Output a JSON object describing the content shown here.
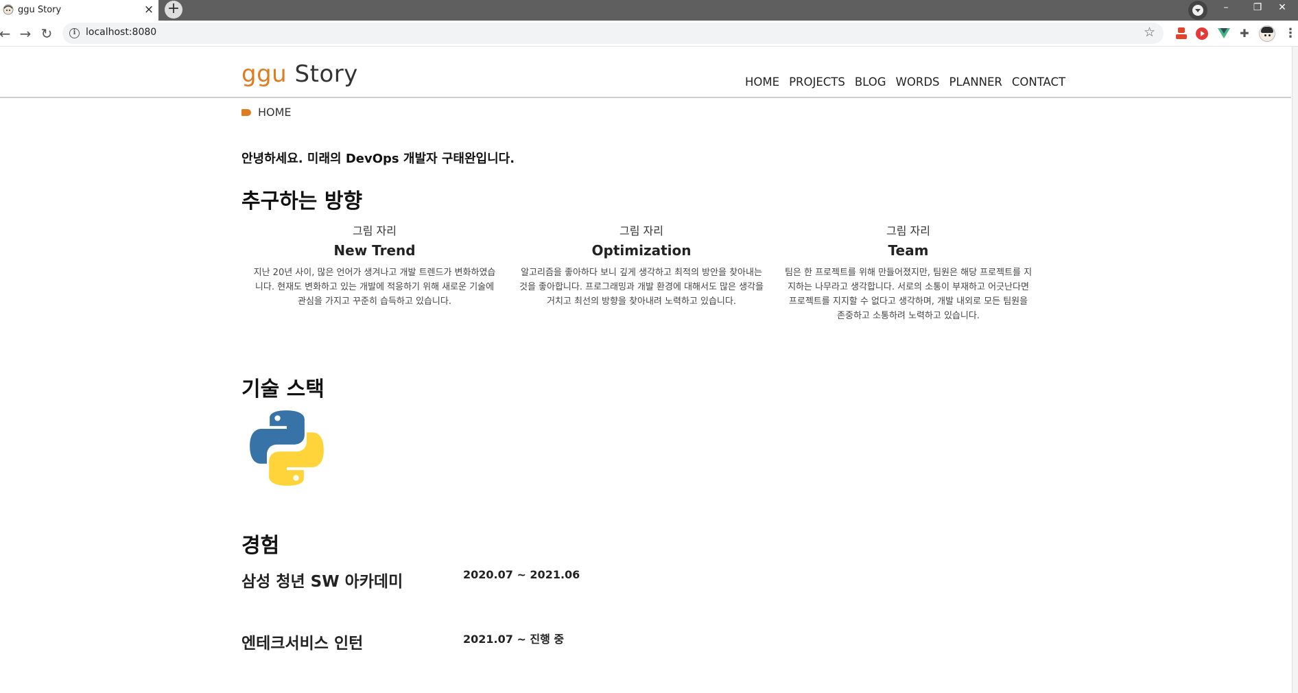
{
  "browser": {
    "tab": {
      "title": "ggu Story",
      "close": "×"
    },
    "new_tab": "+",
    "window_controls": {
      "minimize": "–",
      "restore": "❐",
      "close": "✕"
    },
    "nav": {
      "back": "←",
      "forward": "→",
      "reload": "↻"
    },
    "address_bar": {
      "url": "localhost:8080",
      "info": "i",
      "bookmark": "☆"
    },
    "extensions": [
      "network-extension-icon",
      "video-extension-icon",
      "vue-devtools-icon",
      "extensions-puzzle-icon"
    ],
    "menu": "⋮",
    "colors": {
      "tabbar": "#5f5f5f",
      "omnibox": "#f1f3f4"
    }
  },
  "site": {
    "logo_accent": "ggu",
    "logo_rest": "Story",
    "accent_color": "#e07b1f",
    "nav": [
      "HOME",
      "PROJECTS",
      "BLOG",
      "WORDS",
      "PLANNER",
      "CONTACT"
    ],
    "breadcrumb": "HOME"
  },
  "main": {
    "intro": "안녕하세요. 미래의 DevOps 개발자 구태완입니다.",
    "direction_heading": "추구하는 방향",
    "cards": [
      {
        "image_placeholder": "그림 자리",
        "title": "New Trend",
        "description": "지난 20년 사이, 많은 언어가 생겨나고 개발 트렌드가 변화하였습니다. 현재도 변화하고 있는 개발에 적응하기 위해 새로운 기술에 관심을 가지고 꾸준히 습득하고 있습니다."
      },
      {
        "image_placeholder": "그림 자리",
        "title": "Optimization",
        "description": "알고리즘을 좋아하다 보니 깊게 생각하고 최적의 방안을 찾아내는 것을 좋아합니다. 프로그래밍과 개발 환경에 대해서도 많은 생각을 거치고 최선의 방향을 찾아내려 노력하고 있습니다."
      },
      {
        "image_placeholder": "그림 자리",
        "title": "Team",
        "description": "팀은 한 프로젝트를 위해 만들어졌지만, 팀원은 해당 프로젝트를 지지하는 나무라고 생각합니다. 서로의 소통이 부재하고 어긋난다면 프로젝트를 지지할 수 없다고 생각하며, 개발 내외로 모든 팀원을 존중하고 소통하려 노력하고 있습니다."
      }
    ],
    "tech_heading": "기술 스택",
    "tech_stack": [
      {
        "icon": "python-logo",
        "colors": {
          "blue": "#3873a7",
          "yellow": "#ffd43b"
        }
      }
    ],
    "experience_heading": "경험",
    "experience": [
      {
        "name": "삼성 청년 SW 아카데미",
        "period": "2020.07 ~ 2021.06"
      },
      {
        "name": "엔테크서비스 인턴",
        "period": "2021.07 ~ 진행 중"
      }
    ]
  }
}
